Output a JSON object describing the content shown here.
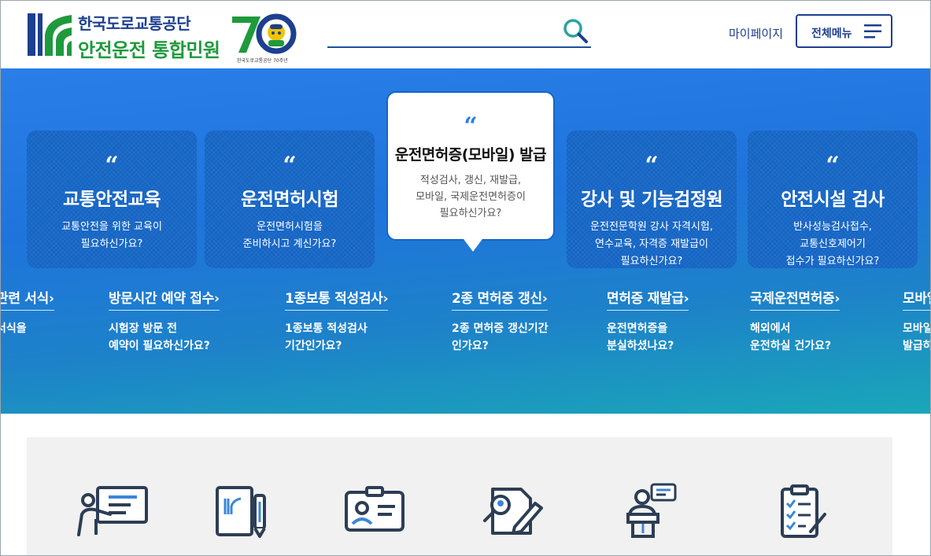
{
  "header": {
    "brand_line1": "한국도로교통공단",
    "brand_line2": "안전운전 통합민원",
    "anniversary_caption": "한국도로교통공단 70주년",
    "search_placeholder": "",
    "mypage_label": "마이페이지",
    "menu_label": "전체메뉴"
  },
  "colors": {
    "brand_blue": "#1d3f8f",
    "brand_green": "#1e9a3c",
    "hero_blue": "#2a7ee8",
    "card_blue": "#1565c4"
  },
  "cards": [
    {
      "quote": "“",
      "title": "교통안전교육",
      "desc": "교통안전을 위한 교육이\n필요하신가요?"
    },
    {
      "quote": "“",
      "title": "운전면허시험",
      "desc": "운전면허시험을\n준비하시고 계신가요?"
    },
    {
      "quote": "“",
      "title": "운전면허증(모바일) 발급",
      "desc": "적성검사, 갱신, 재발급,\n모바일, 국제운전면허증이\n필요하신가요?"
    },
    {
      "quote": "“",
      "title": "강사 및 기능검정원",
      "desc": "운전전문학원 강사 자격시험,\n연수교육, 자격증 재발급이\n필요하신가요?"
    },
    {
      "quote": "“",
      "title": "안전시설 검사",
      "desc": "반사성능검사접수,\n교통신호제어기\n접수가 필요하신가요?"
    }
  ],
  "quick_links": [
    {
      "title": "관련 서식",
      "desc": "서식을"
    },
    {
      "title": "방문시간 예약 접수",
      "desc": "시험장 방문 전\n예약이 필요하신가요?"
    },
    {
      "title": "1종보통 적성검사",
      "desc": "1종보통 적성검사\n기간인가요?"
    },
    {
      "title": "2종 면허증 갱신",
      "desc": "2종 면허증 갱신기간\n인가요?"
    },
    {
      "title": "면허증 재발급",
      "desc": "운전면허증을\n분실하셨나요?"
    },
    {
      "title": "국제운전면허증",
      "desc": "해외에서\n운전하실 건가요?"
    },
    {
      "title": "모바일",
      "desc": "모바일\n발급하"
    }
  ],
  "chevron": "›",
  "icons": [
    "lecture-icon",
    "license-document-icon",
    "id-card-icon",
    "search-document-icon",
    "speaker-podium-icon",
    "checklist-icon"
  ]
}
